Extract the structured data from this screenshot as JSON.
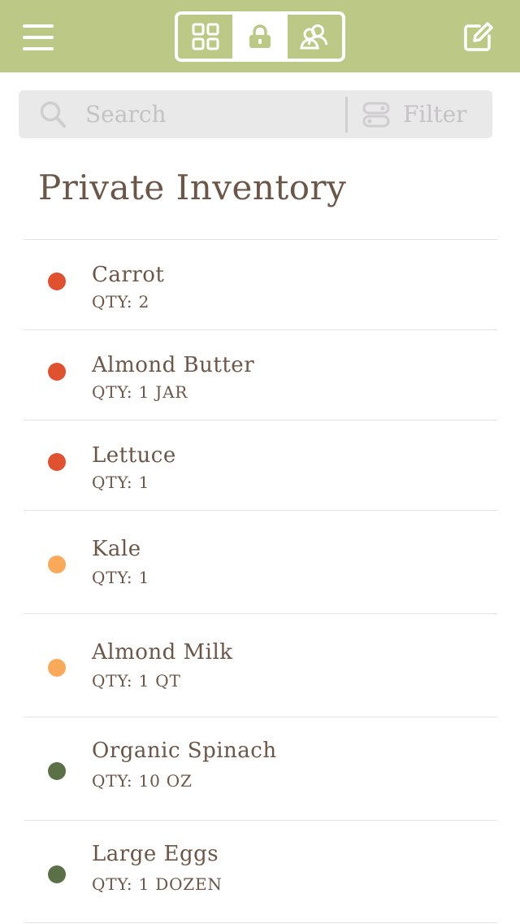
{
  "header": {
    "menu_icon": "hamburger-menu-icon",
    "segments": [
      {
        "icon": "grid-icon",
        "active": false
      },
      {
        "icon": "lock-icon",
        "active": true
      },
      {
        "icon": "shared-users-icon",
        "active": false
      }
    ],
    "edit_icon": "edit-pencil-icon",
    "colors": {
      "bar": "#bcc885",
      "icon": "#ffffff"
    }
  },
  "search": {
    "placeholder": "Search",
    "value": "",
    "filter_label": "Filter"
  },
  "page_title": "Private Inventory",
  "colors": {
    "text": "#6b5647",
    "status_red": "#e0522f",
    "status_orange": "#f9a95a",
    "status_green": "#5c7048"
  },
  "items": [
    {
      "name": "Carrot",
      "qty": "QTY: 2",
      "status": "red"
    },
    {
      "name": "Almond Butter",
      "qty": "QTY: 1 JAR",
      "status": "red"
    },
    {
      "name": "Lettuce",
      "qty": "QTY: 1",
      "status": "red"
    },
    {
      "name": "Kale",
      "qty": "QTY: 1",
      "status": "orange"
    },
    {
      "name": "Almond Milk",
      "qty": "QTY: 1 QT",
      "status": "orange"
    },
    {
      "name": "Organic Spinach",
      "qty": "QTY: 10 OZ",
      "status": "green"
    },
    {
      "name": "Large Eggs",
      "qty": "QTY: 1 DOZEN",
      "status": "green"
    }
  ]
}
